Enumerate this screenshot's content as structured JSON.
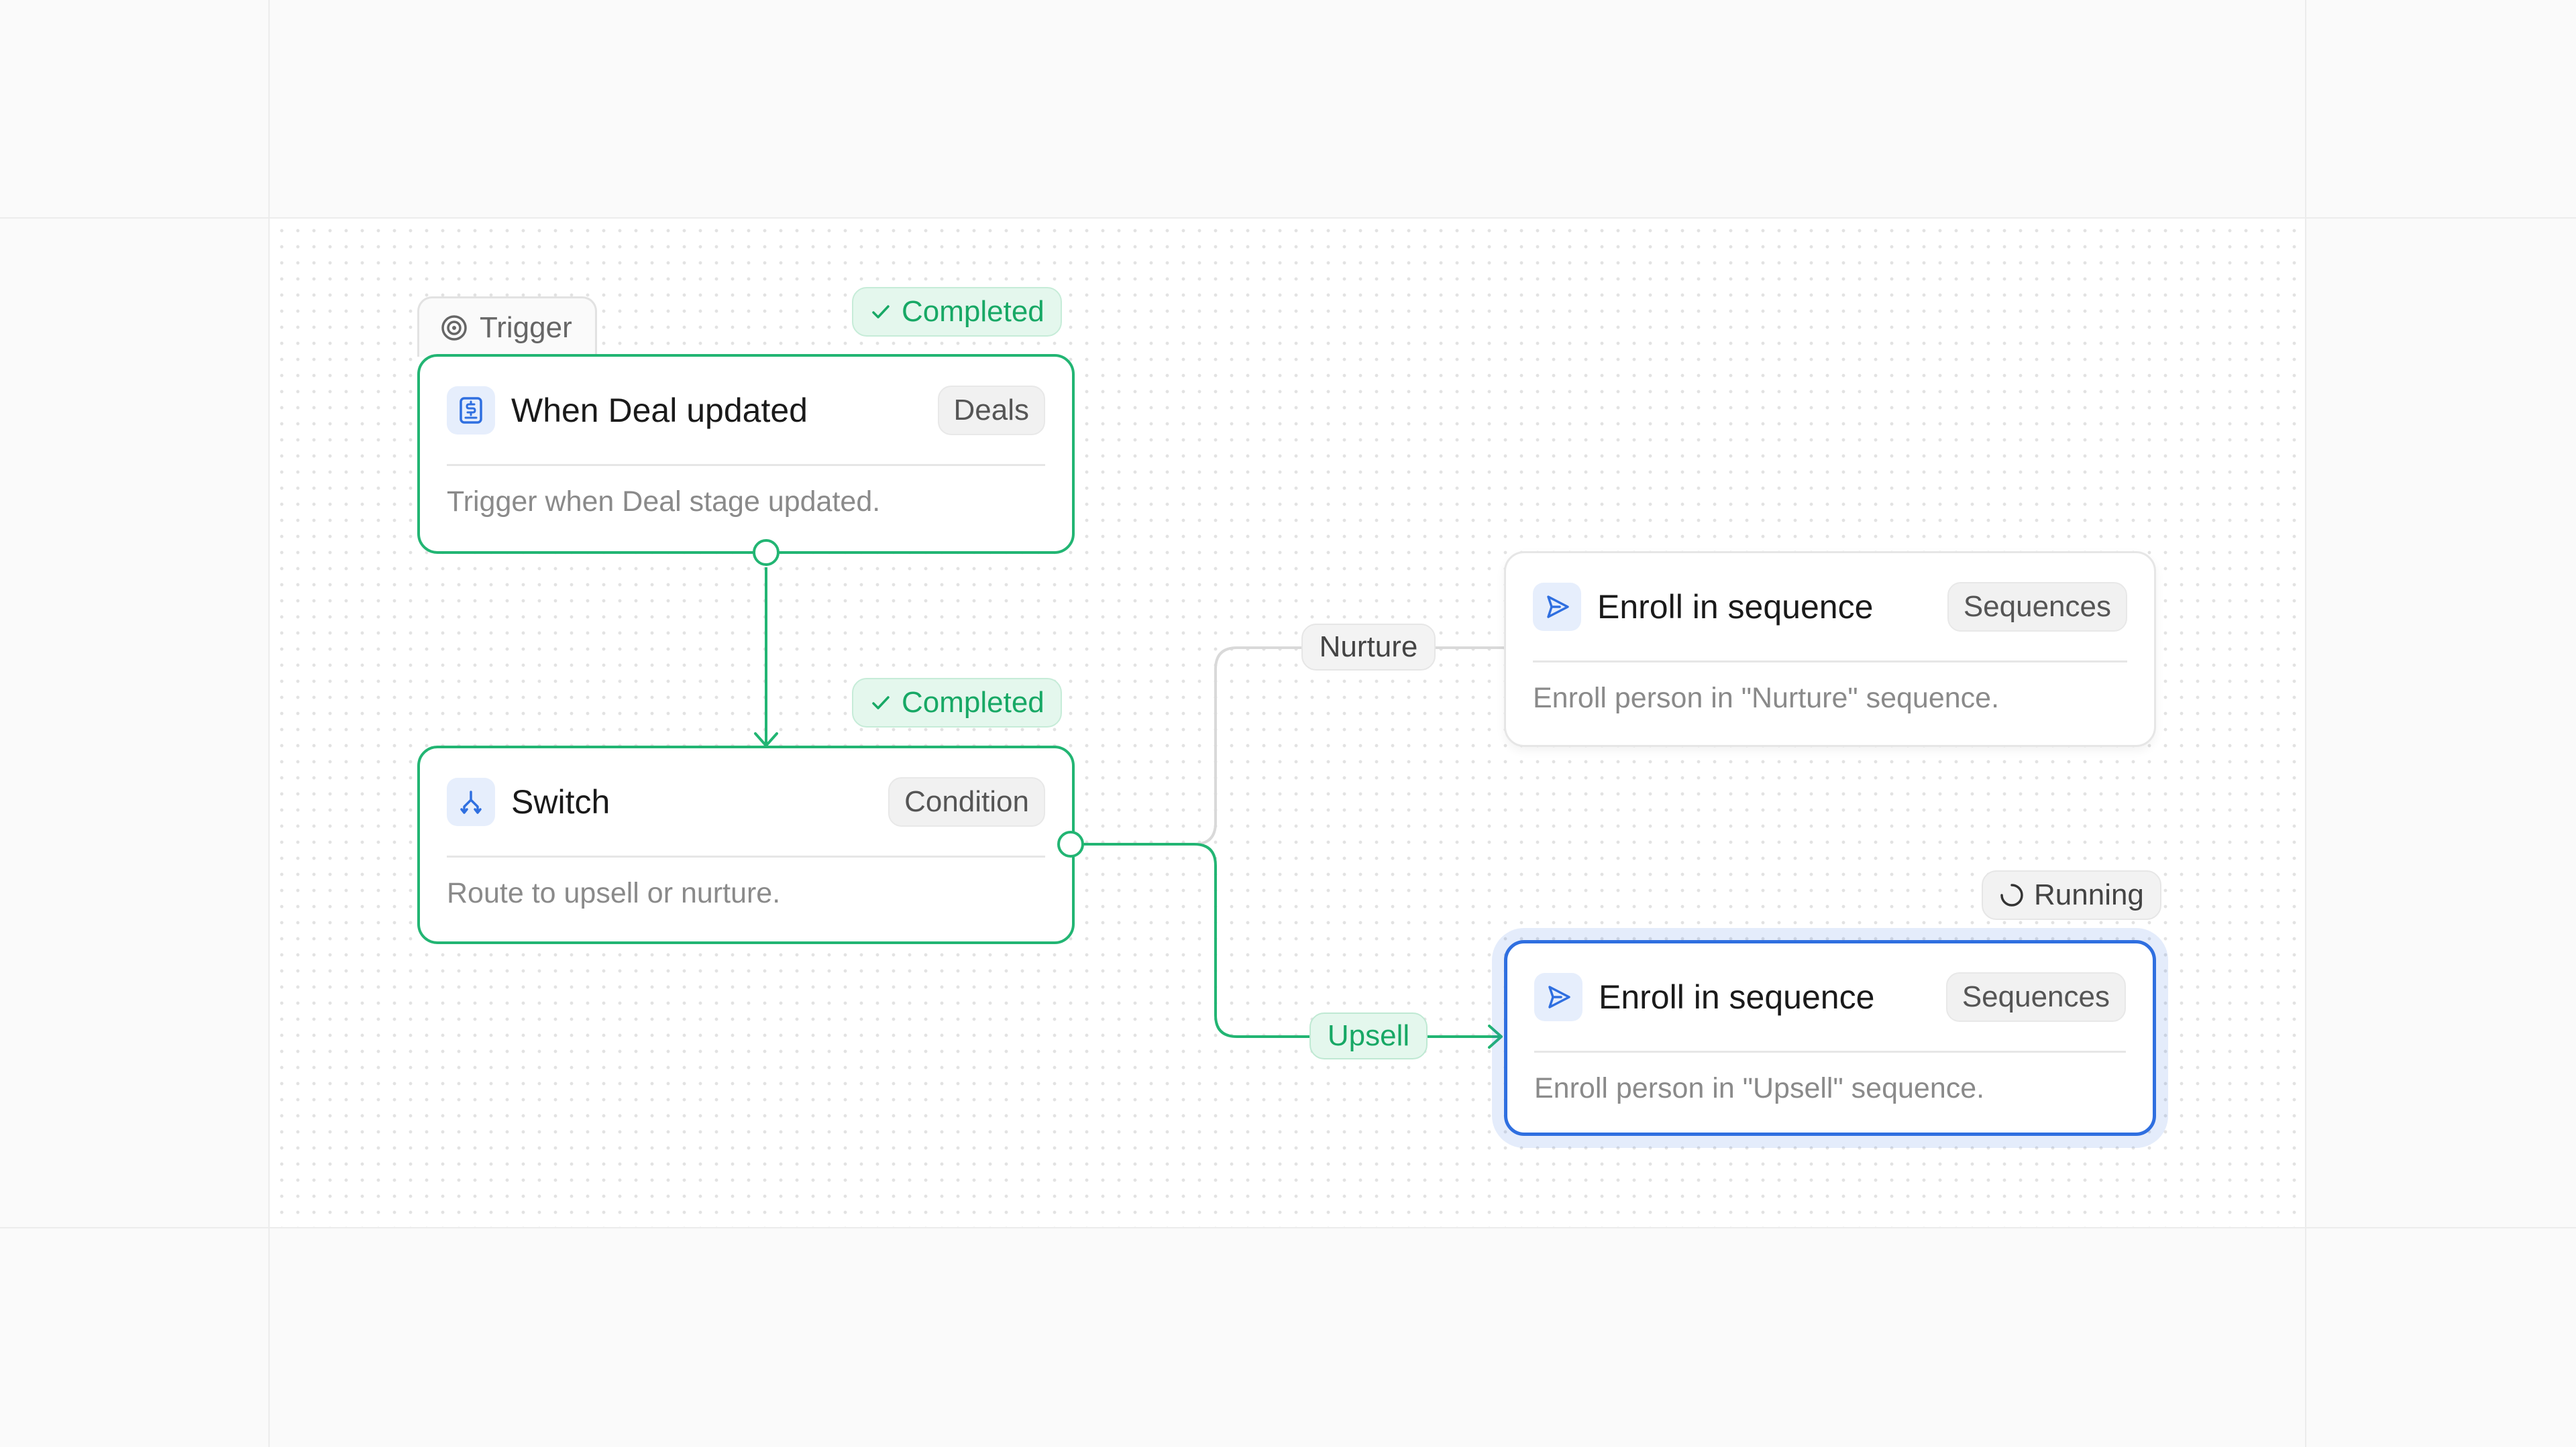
{
  "colors": {
    "completed": "#22b573",
    "active": "#2f6fe0",
    "inactive_edge": "#d9d9d9",
    "icon_bg": "#e6eefc"
  },
  "trigger_tab": {
    "label": "Trigger",
    "icon": "target-icon"
  },
  "nodes": {
    "trigger": {
      "title": "When Deal updated",
      "category": "Deals",
      "description": "Trigger when Deal stage updated.",
      "icon": "deal-icon",
      "status": "Completed"
    },
    "switch": {
      "title": "Switch",
      "category": "Condition",
      "description": "Route to upsell or nurture.",
      "icon": "branch-icon",
      "status": "Completed"
    },
    "nurture": {
      "title": "Enroll in sequence",
      "category": "Sequences",
      "description": "Enroll person in \"Nurture\" sequence.",
      "icon": "send-icon"
    },
    "upsell": {
      "title": "Enroll in sequence",
      "category": "Sequences",
      "description": "Enroll person in \"Upsell\" sequence.",
      "icon": "send-icon",
      "status": "Running"
    }
  },
  "edges": {
    "nurture_label": "Nurture",
    "upsell_label": "Upsell"
  }
}
